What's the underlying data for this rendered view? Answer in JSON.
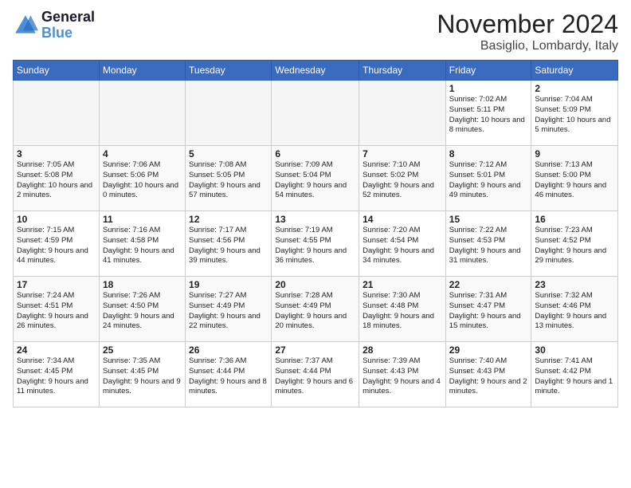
{
  "logo": {
    "line1": "General",
    "line2": "Blue"
  },
  "title": "November 2024",
  "location": "Basiglio, Lombardy, Italy",
  "days_of_week": [
    "Sunday",
    "Monday",
    "Tuesday",
    "Wednesday",
    "Thursday",
    "Friday",
    "Saturday"
  ],
  "weeks": [
    [
      {
        "day": "",
        "info": ""
      },
      {
        "day": "",
        "info": ""
      },
      {
        "day": "",
        "info": ""
      },
      {
        "day": "",
        "info": ""
      },
      {
        "day": "",
        "info": ""
      },
      {
        "day": "1",
        "info": "Sunrise: 7:02 AM\nSunset: 5:11 PM\nDaylight: 10 hours\nand 8 minutes."
      },
      {
        "day": "2",
        "info": "Sunrise: 7:04 AM\nSunset: 5:09 PM\nDaylight: 10 hours\nand 5 minutes."
      }
    ],
    [
      {
        "day": "3",
        "info": "Sunrise: 7:05 AM\nSunset: 5:08 PM\nDaylight: 10 hours\nand 2 minutes."
      },
      {
        "day": "4",
        "info": "Sunrise: 7:06 AM\nSunset: 5:06 PM\nDaylight: 10 hours\nand 0 minutes."
      },
      {
        "day": "5",
        "info": "Sunrise: 7:08 AM\nSunset: 5:05 PM\nDaylight: 9 hours\nand 57 minutes."
      },
      {
        "day": "6",
        "info": "Sunrise: 7:09 AM\nSunset: 5:04 PM\nDaylight: 9 hours\nand 54 minutes."
      },
      {
        "day": "7",
        "info": "Sunrise: 7:10 AM\nSunset: 5:02 PM\nDaylight: 9 hours\nand 52 minutes."
      },
      {
        "day": "8",
        "info": "Sunrise: 7:12 AM\nSunset: 5:01 PM\nDaylight: 9 hours\nand 49 minutes."
      },
      {
        "day": "9",
        "info": "Sunrise: 7:13 AM\nSunset: 5:00 PM\nDaylight: 9 hours\nand 46 minutes."
      }
    ],
    [
      {
        "day": "10",
        "info": "Sunrise: 7:15 AM\nSunset: 4:59 PM\nDaylight: 9 hours\nand 44 minutes."
      },
      {
        "day": "11",
        "info": "Sunrise: 7:16 AM\nSunset: 4:58 PM\nDaylight: 9 hours\nand 41 minutes."
      },
      {
        "day": "12",
        "info": "Sunrise: 7:17 AM\nSunset: 4:56 PM\nDaylight: 9 hours\nand 39 minutes."
      },
      {
        "day": "13",
        "info": "Sunrise: 7:19 AM\nSunset: 4:55 PM\nDaylight: 9 hours\nand 36 minutes."
      },
      {
        "day": "14",
        "info": "Sunrise: 7:20 AM\nSunset: 4:54 PM\nDaylight: 9 hours\nand 34 minutes."
      },
      {
        "day": "15",
        "info": "Sunrise: 7:22 AM\nSunset: 4:53 PM\nDaylight: 9 hours\nand 31 minutes."
      },
      {
        "day": "16",
        "info": "Sunrise: 7:23 AM\nSunset: 4:52 PM\nDaylight: 9 hours\nand 29 minutes."
      }
    ],
    [
      {
        "day": "17",
        "info": "Sunrise: 7:24 AM\nSunset: 4:51 PM\nDaylight: 9 hours\nand 26 minutes."
      },
      {
        "day": "18",
        "info": "Sunrise: 7:26 AM\nSunset: 4:50 PM\nDaylight: 9 hours\nand 24 minutes."
      },
      {
        "day": "19",
        "info": "Sunrise: 7:27 AM\nSunset: 4:49 PM\nDaylight: 9 hours\nand 22 minutes."
      },
      {
        "day": "20",
        "info": "Sunrise: 7:28 AM\nSunset: 4:49 PM\nDaylight: 9 hours\nand 20 minutes."
      },
      {
        "day": "21",
        "info": "Sunrise: 7:30 AM\nSunset: 4:48 PM\nDaylight: 9 hours\nand 18 minutes."
      },
      {
        "day": "22",
        "info": "Sunrise: 7:31 AM\nSunset: 4:47 PM\nDaylight: 9 hours\nand 15 minutes."
      },
      {
        "day": "23",
        "info": "Sunrise: 7:32 AM\nSunset: 4:46 PM\nDaylight: 9 hours\nand 13 minutes."
      }
    ],
    [
      {
        "day": "24",
        "info": "Sunrise: 7:34 AM\nSunset: 4:45 PM\nDaylight: 9 hours\nand 11 minutes."
      },
      {
        "day": "25",
        "info": "Sunrise: 7:35 AM\nSunset: 4:45 PM\nDaylight: 9 hours\nand 9 minutes."
      },
      {
        "day": "26",
        "info": "Sunrise: 7:36 AM\nSunset: 4:44 PM\nDaylight: 9 hours\nand 8 minutes."
      },
      {
        "day": "27",
        "info": "Sunrise: 7:37 AM\nSunset: 4:44 PM\nDaylight: 9 hours\nand 6 minutes."
      },
      {
        "day": "28",
        "info": "Sunrise: 7:39 AM\nSunset: 4:43 PM\nDaylight: 9 hours\nand 4 minutes."
      },
      {
        "day": "29",
        "info": "Sunrise: 7:40 AM\nSunset: 4:43 PM\nDaylight: 9 hours\nand 2 minutes."
      },
      {
        "day": "30",
        "info": "Sunrise: 7:41 AM\nSunset: 4:42 PM\nDaylight: 9 hours\nand 1 minute."
      }
    ]
  ]
}
